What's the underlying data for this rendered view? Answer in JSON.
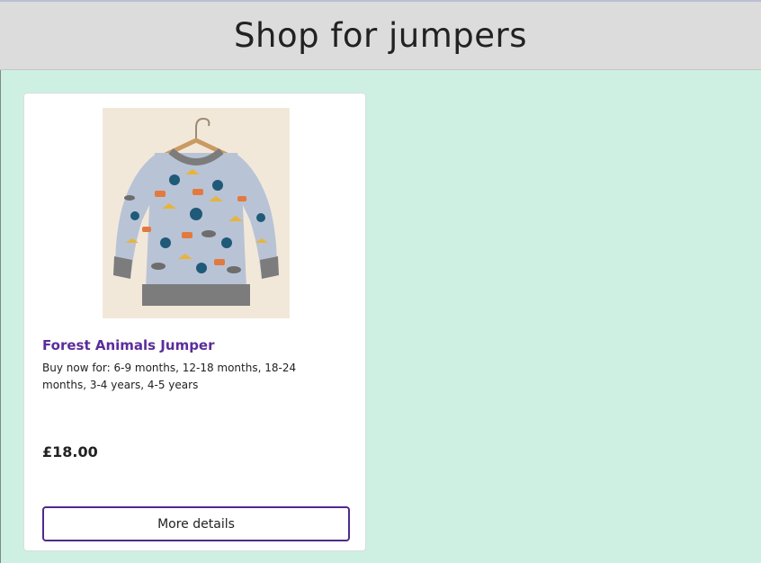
{
  "header": {
    "title": "Shop for jumpers"
  },
  "products": [
    {
      "name": "Forest Animals Jumper",
      "sizes_text": "Buy now for: 6-9 months, 12-18 months, 18-24 months, 3-4 years, 4-5 years",
      "price": "£18.00",
      "button_label": "More details",
      "image_alt": "Forest Animals Jumper"
    }
  ],
  "colors": {
    "page_background": "#cdf0e3",
    "header_background": "#dcdcdc",
    "accent_purple": "#5b2d9b",
    "button_border": "#4f2a8f"
  }
}
